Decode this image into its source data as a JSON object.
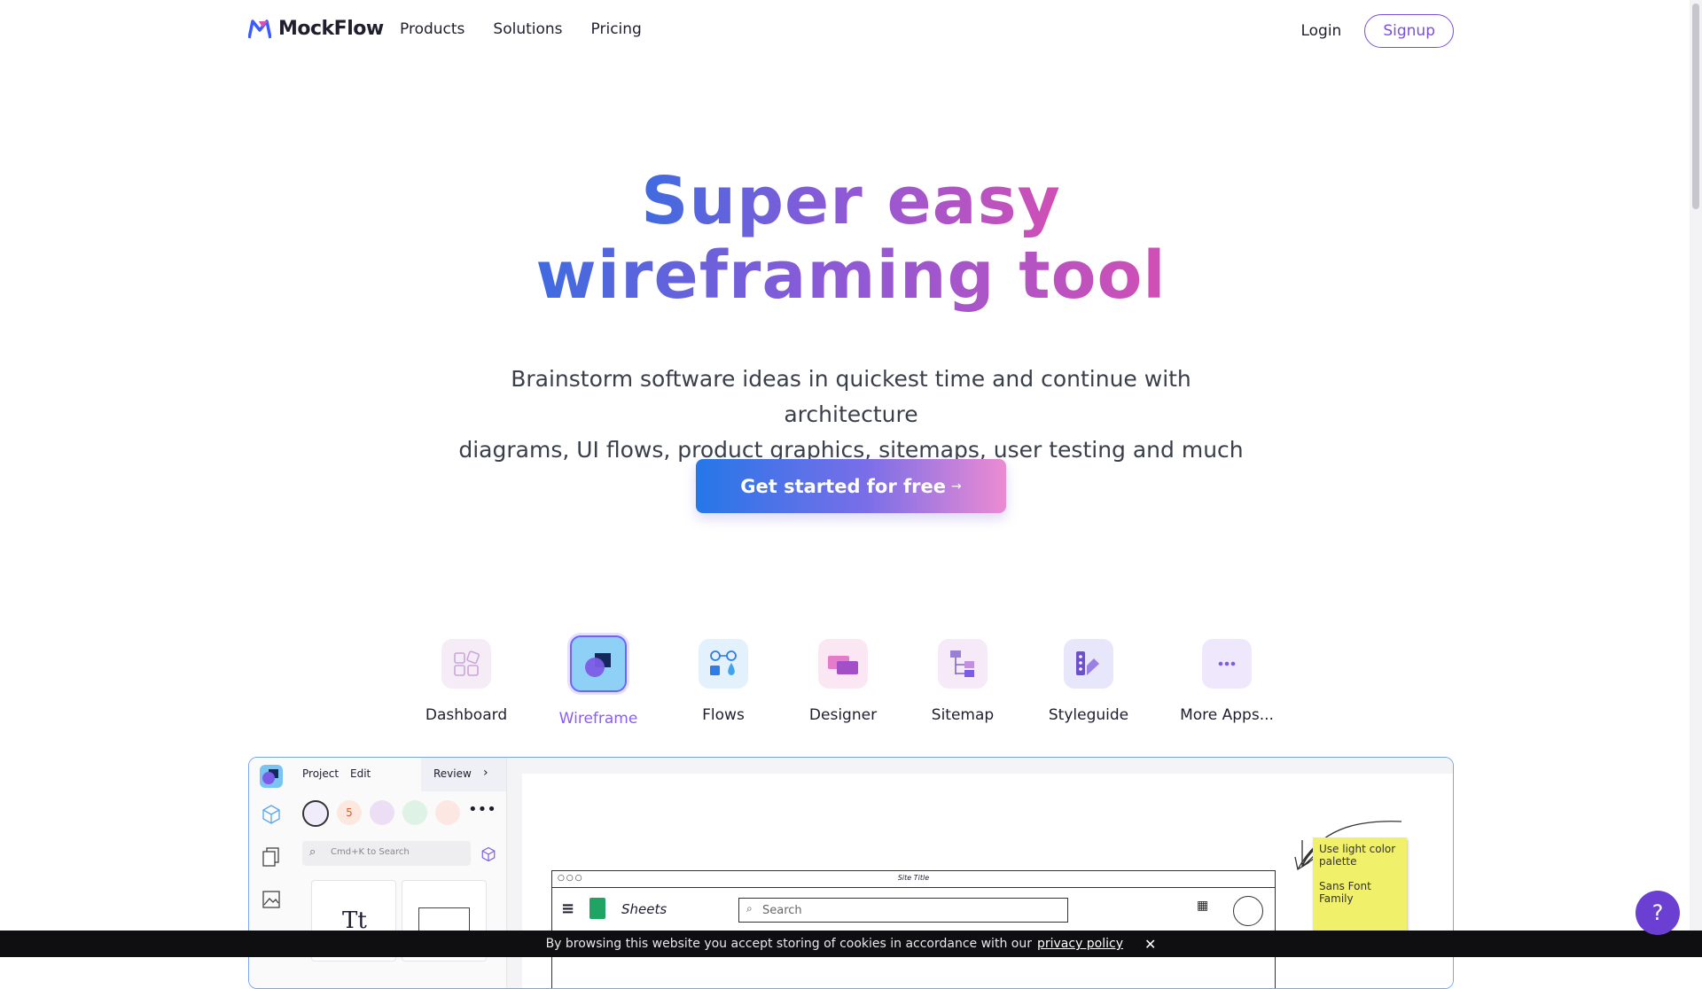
{
  "brand": {
    "name": "MockFlow"
  },
  "nav": {
    "links": [
      "Products",
      "Solutions",
      "Pricing"
    ],
    "login": "Login",
    "signup": "Signup"
  },
  "hero": {
    "title_line1": "Super easy",
    "title_line2": "wireframing tool",
    "subtitle_line1": "Brainstorm software ideas in quickest time and continue with architecture",
    "subtitle_line2": "diagrams, UI flows, product graphics, sitemaps, user testing and much more...",
    "cta_label": "Get started for free",
    "cta_arrow": "→"
  },
  "apps": [
    {
      "label": "Dashboard",
      "icon": "dashboard-icon",
      "active": false
    },
    {
      "label": "Wireframe",
      "icon": "wireframe-icon",
      "active": true
    },
    {
      "label": "Flows",
      "icon": "flows-icon",
      "active": false
    },
    {
      "label": "Designer",
      "icon": "designer-icon",
      "active": false
    },
    {
      "label": "Sitemap",
      "icon": "sitemap-icon",
      "active": false
    },
    {
      "label": "Styleguide",
      "icon": "styleguide-icon",
      "active": false
    },
    {
      "label": "More Apps...",
      "icon": "more-apps-icon",
      "active": false
    }
  ],
  "preview": {
    "menu": [
      "Project",
      "Edit"
    ],
    "review": "Review",
    "search_placeholder": "Cmd+K to Search",
    "text_tool": "Tt",
    "site_title": "Site Title",
    "sheets_label": "Sheets",
    "wire_search": "Search",
    "note_line1": "Use light color palette",
    "note_line2": "Sans Font Family"
  },
  "cookie": {
    "text": "By browsing this website you accept storing of cookies in accordance with our",
    "link": "privacy policy",
    "close": "✕"
  },
  "help": {
    "label": "?"
  },
  "colors": {
    "brand_purple": "#7b4fd8",
    "help_button": "#6b3fd1",
    "active_app": "#8b5cf6"
  }
}
